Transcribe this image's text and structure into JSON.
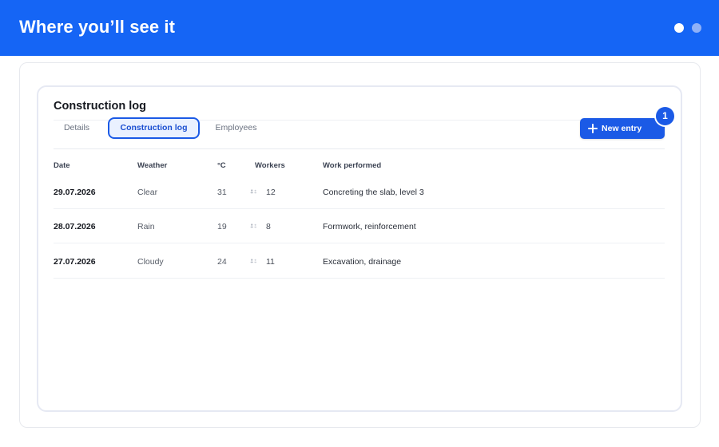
{
  "header": {
    "title": "Where you’ll see it"
  },
  "log": {
    "title": "Construction log"
  },
  "tabs": [
    {
      "label": "Details"
    },
    {
      "label": "Construction log"
    },
    {
      "label": "Employees"
    }
  ],
  "actions": {
    "new_entry_label": "New entry",
    "badge": "1"
  },
  "table": {
    "columns": [
      "Date",
      "Weather",
      "°C",
      "Workers",
      "Work performed"
    ],
    "rows": [
      {
        "date": "29.07.2026",
        "weather": "Clear",
        "temp": "31",
        "workers": "12",
        "work": "Concreting the slab, level 3"
      },
      {
        "date": "28.07.2026",
        "weather": "Rain",
        "temp": "19",
        "workers": "8",
        "work": "Formwork, reinforcement"
      },
      {
        "date": "27.07.2026",
        "weather": "Cloudy",
        "temp": "24",
        "workers": "11",
        "work": "Excavation, drainage"
      }
    ]
  },
  "colors": {
    "brand": "#1565f5",
    "accent": "#1b5ae6",
    "tab_active_bg": "#eaf1ff"
  },
  "icons": {
    "new_entry": "plus-icon",
    "workers": "people-icon"
  }
}
